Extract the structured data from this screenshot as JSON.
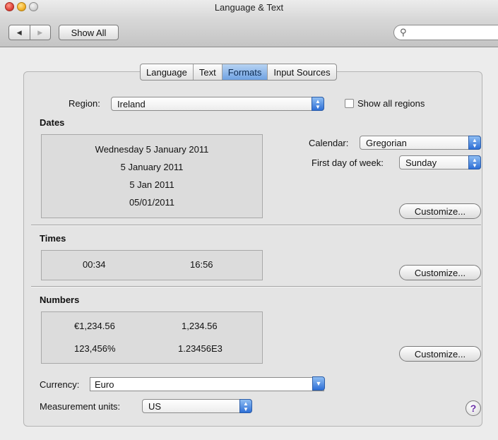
{
  "window": {
    "title": "Language & Text"
  },
  "toolbar": {
    "back": "◀",
    "forward": "▶",
    "show_all": "Show All",
    "search_placeholder": ""
  },
  "tabs": [
    {
      "label": "Language"
    },
    {
      "label": "Text"
    },
    {
      "label": "Formats",
      "active": true
    },
    {
      "label": "Input Sources"
    }
  ],
  "region": {
    "label": "Region:",
    "value": "Ireland",
    "show_all_label": "Show all regions",
    "show_all_checked": false
  },
  "dates": {
    "heading": "Dates",
    "preview": [
      "Wednesday 5 January 2011",
      "5 January 2011",
      "5 Jan 2011",
      "05/01/2011"
    ],
    "calendar_label": "Calendar:",
    "calendar_value": "Gregorian",
    "first_day_label": "First day of week:",
    "first_day_value": "Sunday",
    "customize": "Customize..."
  },
  "times": {
    "heading": "Times",
    "preview": [
      "00:34",
      "16:56"
    ],
    "customize": "Customize..."
  },
  "numbers": {
    "heading": "Numbers",
    "preview": [
      "€1,234.56",
      "1,234.56",
      "123,456%",
      "1.23456E3"
    ],
    "customize": "Customize..."
  },
  "currency": {
    "label": "Currency:",
    "value": "Euro"
  },
  "measurement": {
    "label": "Measurement units:",
    "value": "US"
  },
  "help": {
    "label": "?"
  }
}
